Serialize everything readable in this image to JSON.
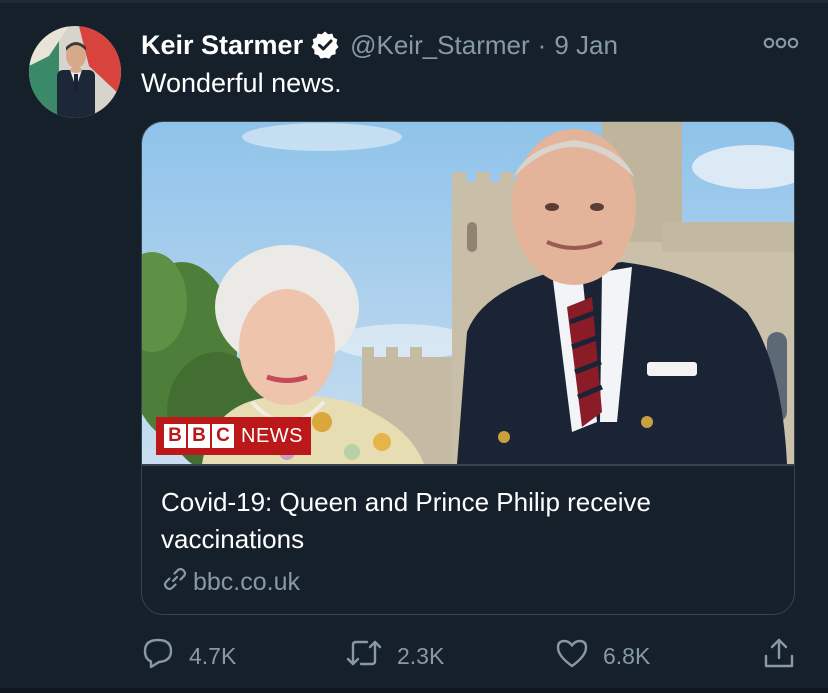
{
  "tweet": {
    "author_name": "Keir Starmer",
    "handle": "@Keir_Starmer",
    "separator": "·",
    "time": "9 Jan",
    "text": "Wonderful news."
  },
  "card": {
    "title": "Covid-19: Queen and Prince Philip receive vaccinations",
    "domain": "bbc.co.uk",
    "badge": {
      "letters": [
        "B",
        "B",
        "C"
      ],
      "word": "NEWS"
    }
  },
  "actions": {
    "reply_count": "4.7K",
    "retweet_count": "2.3K",
    "like_count": "6.8K"
  },
  "icons": {
    "verified": "verified-badge-icon",
    "more": "more-options-icon",
    "link": "link-icon",
    "reply": "reply-icon",
    "retweet": "retweet-icon",
    "like": "heart-icon",
    "share": "share-icon"
  },
  "colors": {
    "background": "#15202b",
    "text_primary": "#ffffff",
    "text_secondary": "#8899a6",
    "border": "#38444d",
    "bbc_red": "#bb1919"
  }
}
